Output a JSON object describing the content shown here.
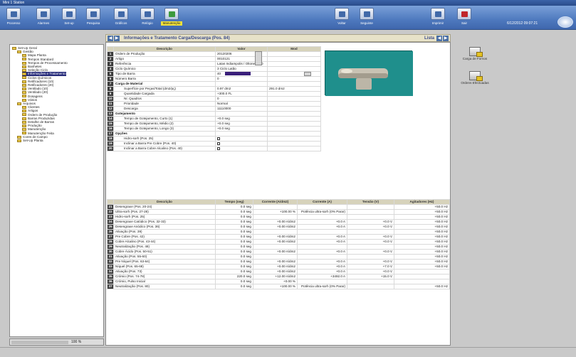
{
  "window": {
    "title": "Mini 1 Station"
  },
  "toolbar": {
    "buttons": [
      {
        "label": "Processo",
        "icon": "process-icon"
      },
      {
        "label": "Alarmes",
        "icon": "alarms-icon"
      },
      {
        "label": "Set-up",
        "icon": "setup-icon"
      },
      {
        "label": "Pesquisa",
        "icon": "search-icon"
      },
      {
        "label": "Gráficos",
        "icon": "chart-icon"
      },
      {
        "label": "Relógio",
        "icon": "clock-icon"
      },
      {
        "label": "Manutenção",
        "icon": "maintenance-icon"
      },
      {
        "label": "Voltar",
        "icon": "back-arrow-icon"
      },
      {
        "label": "Seguinte",
        "icon": "forward-arrow-icon"
      },
      {
        "label": "Imprimir",
        "icon": "printer-icon"
      },
      {
        "label": "Sair",
        "icon": "exit-icon"
      }
    ],
    "active_label": "Manutenção",
    "clock": "6/12/2012 09:07:21"
  },
  "subheader": {
    "title": "Informações e Tratamento Carga/Descarga (Pos. 84)",
    "right_label": "Lista"
  },
  "tree": [
    {
      "label": "Set-Up Geral",
      "level": 0
    },
    {
      "label": "Gestão",
      "level": 1
    },
    {
      "label": "Mapa Planta",
      "level": 2
    },
    {
      "label": "Tempos Standard",
      "level": 2
    },
    {
      "label": "Tempos de Processamento",
      "level": 2
    },
    {
      "label": "Banhetes",
      "level": 2
    },
    {
      "label": "Seleção Ciclo",
      "level": 2
    },
    {
      "label": "Informações e Tratamento",
      "level": 2,
      "selected": true
    },
    {
      "label": "Ciclos Químicos",
      "level": 2
    },
    {
      "label": "Retificadores (10)",
      "level": 2
    },
    {
      "label": "Retificadores (20)",
      "level": 2
    },
    {
      "label": "Ventilado (10)",
      "level": 2
    },
    {
      "label": "Ventilado (20)",
      "level": 2
    },
    {
      "label": "Dosagens",
      "level": 2
    },
    {
      "label": "Vários",
      "level": 2
    },
    {
      "label": "Arquivos",
      "level": 1
    },
    {
      "label": "Clientes",
      "level": 2
    },
    {
      "label": "Artigos",
      "level": 2
    },
    {
      "label": "Ordem de Produção",
      "level": 2
    },
    {
      "label": "Barras Produzidas",
      "level": 2
    },
    {
      "label": "Detalhe de Barras",
      "level": 2
    },
    {
      "label": "Produção",
      "level": 2
    },
    {
      "label": "Manutenção",
      "level": 2
    },
    {
      "label": "Manutenção Feita",
      "level": 2
    },
    {
      "label": "Cores de Campo",
      "level": 1
    },
    {
      "label": "Set-Up Planta",
      "level": 1
    }
  ],
  "tree_footer": "100 %",
  "info_table": {
    "headers": [
      "Descrição",
      "Valor",
      "Mod"
    ],
    "rows": [
      {
        "n": "1",
        "desc": "Ordem de Produção",
        "val": "20120206",
        "mod": ""
      },
      {
        "n": "2",
        "desc": "Artigo",
        "val": "0010121",
        "mod": ""
      },
      {
        "n": "3",
        "desc": "Referência",
        "val": "Latas Indiampolis / Oltone / 500",
        "mod": ""
      },
      {
        "n": "4",
        "desc": "Ciclo Químico",
        "val": "3  Ciclo Latão",
        "mod": ""
      },
      {
        "n": "5",
        "desc": "Tipo de Barra",
        "val": "40",
        "mod": ""
      },
      {
        "n": "6",
        "desc": "Número Barra",
        "val": "0",
        "mod": ""
      },
      {
        "n": "7",
        "desc": "Carga de Material",
        "val": "",
        "mod": "",
        "section": true
      },
      {
        "n": "8",
        "desc": "Superfície por Peças/Total (dm2/pç)",
        "val": "0.97 dm2",
        "mod": "291.0 dm2"
      },
      {
        "n": "9",
        "desc": "Quantidade Cargada",
        "val": "+300.0 FL",
        "mod": ""
      },
      {
        "n": "10",
        "desc": "Nr. Quadros",
        "val": "0",
        "mod": ""
      },
      {
        "n": "11",
        "desc": "Prioridade",
        "val": "Normal",
        "mod": ""
      },
      {
        "n": "12",
        "desc": "Descarga",
        "val": "11110000",
        "mod": ""
      },
      {
        "n": "13",
        "desc": "Gotejamento",
        "val": "",
        "mod": "",
        "section": true
      },
      {
        "n": "14",
        "desc": "Tempo de Gotejamento, Curto (1)",
        "val": "+0.0 seg",
        "mod": ""
      },
      {
        "n": "15",
        "desc": "Tempo de Gotejamento, Médio (2)",
        "val": "+0.0 seg",
        "mod": ""
      },
      {
        "n": "16",
        "desc": "Tempo de Gotejamento, Longo (3)",
        "val": "+0.0 seg",
        "mod": ""
      },
      {
        "n": "17",
        "desc": "Opções",
        "val": "",
        "mod": "",
        "section": true
      },
      {
        "n": "18",
        "desc": "Hidro-sorh (Pos. 25)",
        "val": "",
        "mod": "",
        "check": true
      },
      {
        "n": "19",
        "desc": "Inclinar a Barra Pre Cobre (Pos. 40)",
        "val": "",
        "mod": "",
        "check": true
      },
      {
        "n": "20",
        "desc": "Inclinar a Barra Cobre Alcalino (Pos. 40)",
        "val": "",
        "mod": "",
        "check": true
      }
    ]
  },
  "process_table": {
    "headers": [
      "Descrição",
      "Tempo (seg)",
      "Corrente (A/dm2)",
      "Corrente (A)",
      "Tensão (V)",
      "Agitadores (Hz)"
    ],
    "rows": [
      {
        "n": "21",
        "desc": "Desengraxe (Pos. 20-24)",
        "tempo": "0.0 seg",
        "cdens": "",
        "corr": "",
        "tens": "",
        "agit": "+50.0 Hz"
      },
      {
        "n": "22",
        "desc": "Ultra-sorh (Pos. 27-28)",
        "tempo": "0.0 seg",
        "cdens": "+100.00 %",
        "corr": "Potência ultra-sorh (0% Parar)",
        "tens": "",
        "agit": "+50.0 Hz"
      },
      {
        "n": "23",
        "desc": "Hidro-sorh (Pos. 25)",
        "tempo": "0.0 seg",
        "cdens": "",
        "corr": "",
        "tens": "",
        "agit": "+50.0 Hz"
      },
      {
        "n": "24",
        "desc": "Desengraxe Catódico (Pos. 32-33)",
        "tempo": "0.0 seg",
        "cdens": "+0.00 A/dm2",
        "corr": "+0.0 A",
        "tens": "+0.0 V",
        "agit": "+50.0 Hz"
      },
      {
        "n": "25",
        "desc": "Desengraxe Anódico (Pos. 36)",
        "tempo": "0.0 seg",
        "cdens": "+0.00 A/dm2",
        "corr": "+0.0 A",
        "tens": "+0.0 V",
        "agit": "+50.0 Hz"
      },
      {
        "n": "26",
        "desc": "Ativação (Pos. 39)",
        "tempo": "0.0 seg",
        "cdens": "",
        "corr": "",
        "tens": "",
        "agit": "+50.0 Hz"
      },
      {
        "n": "27",
        "desc": "Pre Cobre (Pos. 42)",
        "tempo": "0.0 seg",
        "cdens": "+0.00 A/dm2",
        "corr": "+0.0 A",
        "tens": "+0.0 V",
        "agit": "+50.0 Hz"
      },
      {
        "n": "28",
        "desc": "Cobre Alcalino (Pos. 43-44)",
        "tempo": "0.0 seg",
        "cdens": "+0.00 A/dm2",
        "corr": "+0.0 A",
        "tens": "+0.0 V",
        "agit": "+50.0 Hz"
      },
      {
        "n": "29",
        "desc": "Neutralização (Pos. 48)",
        "tempo": "0.0 seg",
        "cdens": "",
        "corr": "",
        "tens": "",
        "agit": "+50.0 Hz"
      },
      {
        "n": "30",
        "desc": "Cobre Ácido (Pos. 50-51)",
        "tempo": "0.0 seg",
        "cdens": "+0.00 A/dm2",
        "corr": "+0.0 A",
        "tens": "+0.0 V",
        "agit": "+50.0 Hz"
      },
      {
        "n": "31",
        "desc": "Ativação (Pos. 55-60)",
        "tempo": "0.0 seg",
        "cdens": "",
        "corr": "",
        "tens": "",
        "agit": "+50.0 Hz"
      },
      {
        "n": "32",
        "desc": "Pre Níquel (Pos. 63-64)",
        "tempo": "0.0 seg",
        "cdens": "+0.00 A/dm2",
        "corr": "+0.0 A",
        "tens": "+0.0 V",
        "agit": "+50.0 Hz"
      },
      {
        "n": "33",
        "desc": "Níquel (Pos. 65-68)",
        "tempo": "0.0 seg",
        "cdens": "+0.00 A/dm2",
        "corr": "+0.0 A",
        "tens": "+7.0 V",
        "agit": "+50.0 Hz"
      },
      {
        "n": "34",
        "desc": "Ativação (Pos. 73)",
        "tempo": "0.0 seg",
        "cdens": "+0.00 A/dm2",
        "corr": "+0.0 A",
        "tens": "+0.0 V",
        "agit": ""
      },
      {
        "n": "35",
        "desc": "Crómio (Pos. 74-78)",
        "tempo": "220.0 seg",
        "cdens": "+12.00 A/dm2",
        "corr": "+3492.0 A",
        "tens": "+15.0 V",
        "agit": ""
      },
      {
        "n": "36",
        "desc": "Crómio, Pulso Inicial",
        "tempo": "0.0 seg",
        "cdens": "+0.00 %",
        "corr": "",
        "tens": "",
        "agit": ""
      },
      {
        "n": "37",
        "desc": "Neutralização (Pos. 80)",
        "tempo": "0.0 seg",
        "cdens": "+100.00 %",
        "corr": "Potência ultra-sorh (0% Parar)",
        "tens": "",
        "agit": "+50.0 Hz"
      }
    ]
  },
  "side_actions": [
    {
      "label": "Carga de Fornos",
      "icon": "load-furnace-icon"
    },
    {
      "label": "Ordens Efectuadas",
      "icon": "orders-done-icon"
    }
  ],
  "colors": {
    "selection": "#272c7a",
    "photo_bg": "#1f8f8c",
    "toolbar": "#4e79be",
    "swatch": "#3a1f7a"
  }
}
